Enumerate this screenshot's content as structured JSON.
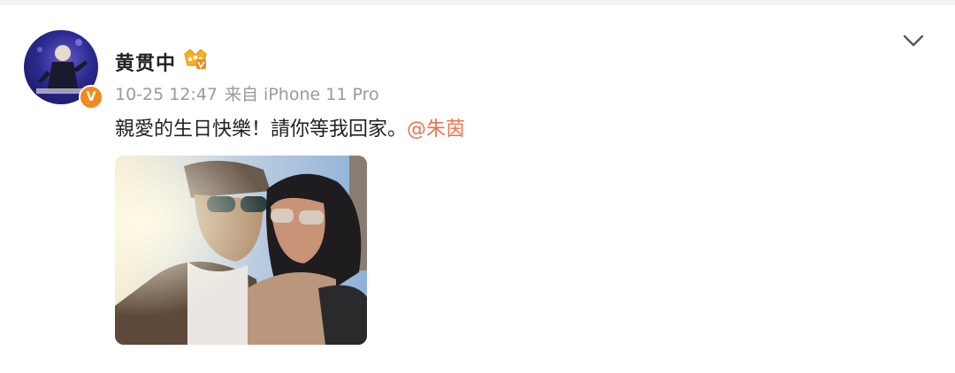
{
  "post": {
    "author": {
      "name": "黄贯中",
      "verified_mark": "V",
      "avatar_icon": "avatar-image",
      "badge_icon": "vip-crown-icon"
    },
    "meta": {
      "time": "10-25 12:47",
      "source": "来自 iPhone 11 Pro"
    },
    "text": {
      "body": "親愛的生日快樂！請你等我回家。",
      "mention": "@朱茵"
    },
    "menu_icon": "chevron-down-icon",
    "photo": {
      "icon": "photo-image"
    }
  },
  "colors": {
    "mention": "#eb7350",
    "meta": "#9a9a9a",
    "verified": "#f08a1c",
    "text": "#222222"
  }
}
